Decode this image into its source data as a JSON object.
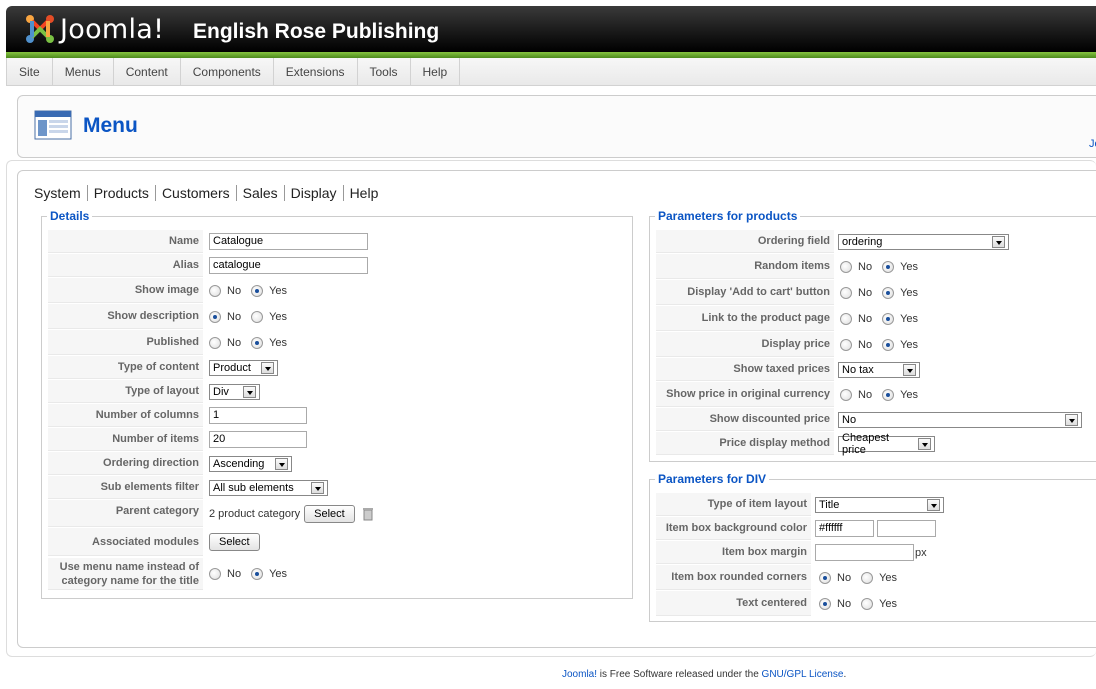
{
  "header": {
    "logo_text": "Joomla!",
    "site_title": "English Rose Publishing"
  },
  "menubar": [
    "Site",
    "Menus",
    "Content",
    "Components",
    "Extensions",
    "Tools",
    "Help"
  ],
  "toolbar": {
    "title": "Menu",
    "right_text": "Jo"
  },
  "subnav": [
    "System",
    "Products",
    "Customers",
    "Sales",
    "Display",
    "Help"
  ],
  "details": {
    "legend": "Details",
    "name_label": "Name",
    "name_value": "Catalogue",
    "alias_label": "Alias",
    "alias_value": "catalogue",
    "show_image_label": "Show image",
    "show_description_label": "Show description",
    "published_label": "Published",
    "type_content_label": "Type of content",
    "type_content_value": "Product",
    "type_layout_label": "Type of layout",
    "type_layout_value": "Div",
    "num_columns_label": "Number of columns",
    "num_columns_value": "1",
    "num_items_label": "Number of items",
    "num_items_value": "20",
    "ordering_dir_label": "Ordering direction",
    "ordering_dir_value": "Ascending",
    "sub_filter_label": "Sub elements filter",
    "sub_filter_value": "All sub elements",
    "parent_cat_label": "Parent category",
    "parent_cat_value": "2 product category",
    "assoc_modules_label": "Associated modules",
    "use_menu_name_label": "Use menu name instead of category name for the title",
    "select_button": "Select",
    "no": "No",
    "yes": "Yes"
  },
  "products": {
    "legend": "Parameters for products",
    "ordering_field_label": "Ordering field",
    "ordering_field_value": "ordering",
    "random_items_label": "Random items",
    "add_to_cart_label": "Display 'Add to cart' button",
    "link_product_label": "Link to the product page",
    "display_price_label": "Display price",
    "show_taxed_label": "Show taxed prices",
    "show_taxed_value": "No tax",
    "orig_currency_label": "Show price in original currency",
    "discounted_label": "Show discounted price",
    "discounted_value": "No",
    "price_method_label": "Price display method",
    "price_method_value": "Cheapest price"
  },
  "div_params": {
    "legend": "Parameters for DIV",
    "item_layout_label": "Type of item layout",
    "item_layout_value": "Title",
    "bg_color_label": "Item box background color",
    "bg_color_value": "#ffffff",
    "margin_label": "Item box margin",
    "margin_unit": "px",
    "rounded_label": "Item box rounded corners",
    "centered_label": "Text centered"
  },
  "radios": {
    "show_image": "yes",
    "show_description": "no",
    "published": "yes",
    "use_menu_name": "yes",
    "random_items": "yes",
    "add_to_cart": "yes",
    "link_product": "yes",
    "display_price": "yes",
    "orig_currency": "yes",
    "rounded": "no",
    "centered": "no"
  },
  "footer": {
    "brand": "Joomla!",
    "middle": " is Free Software released under the ",
    "license": "GNU/GPL License",
    "end": "."
  }
}
